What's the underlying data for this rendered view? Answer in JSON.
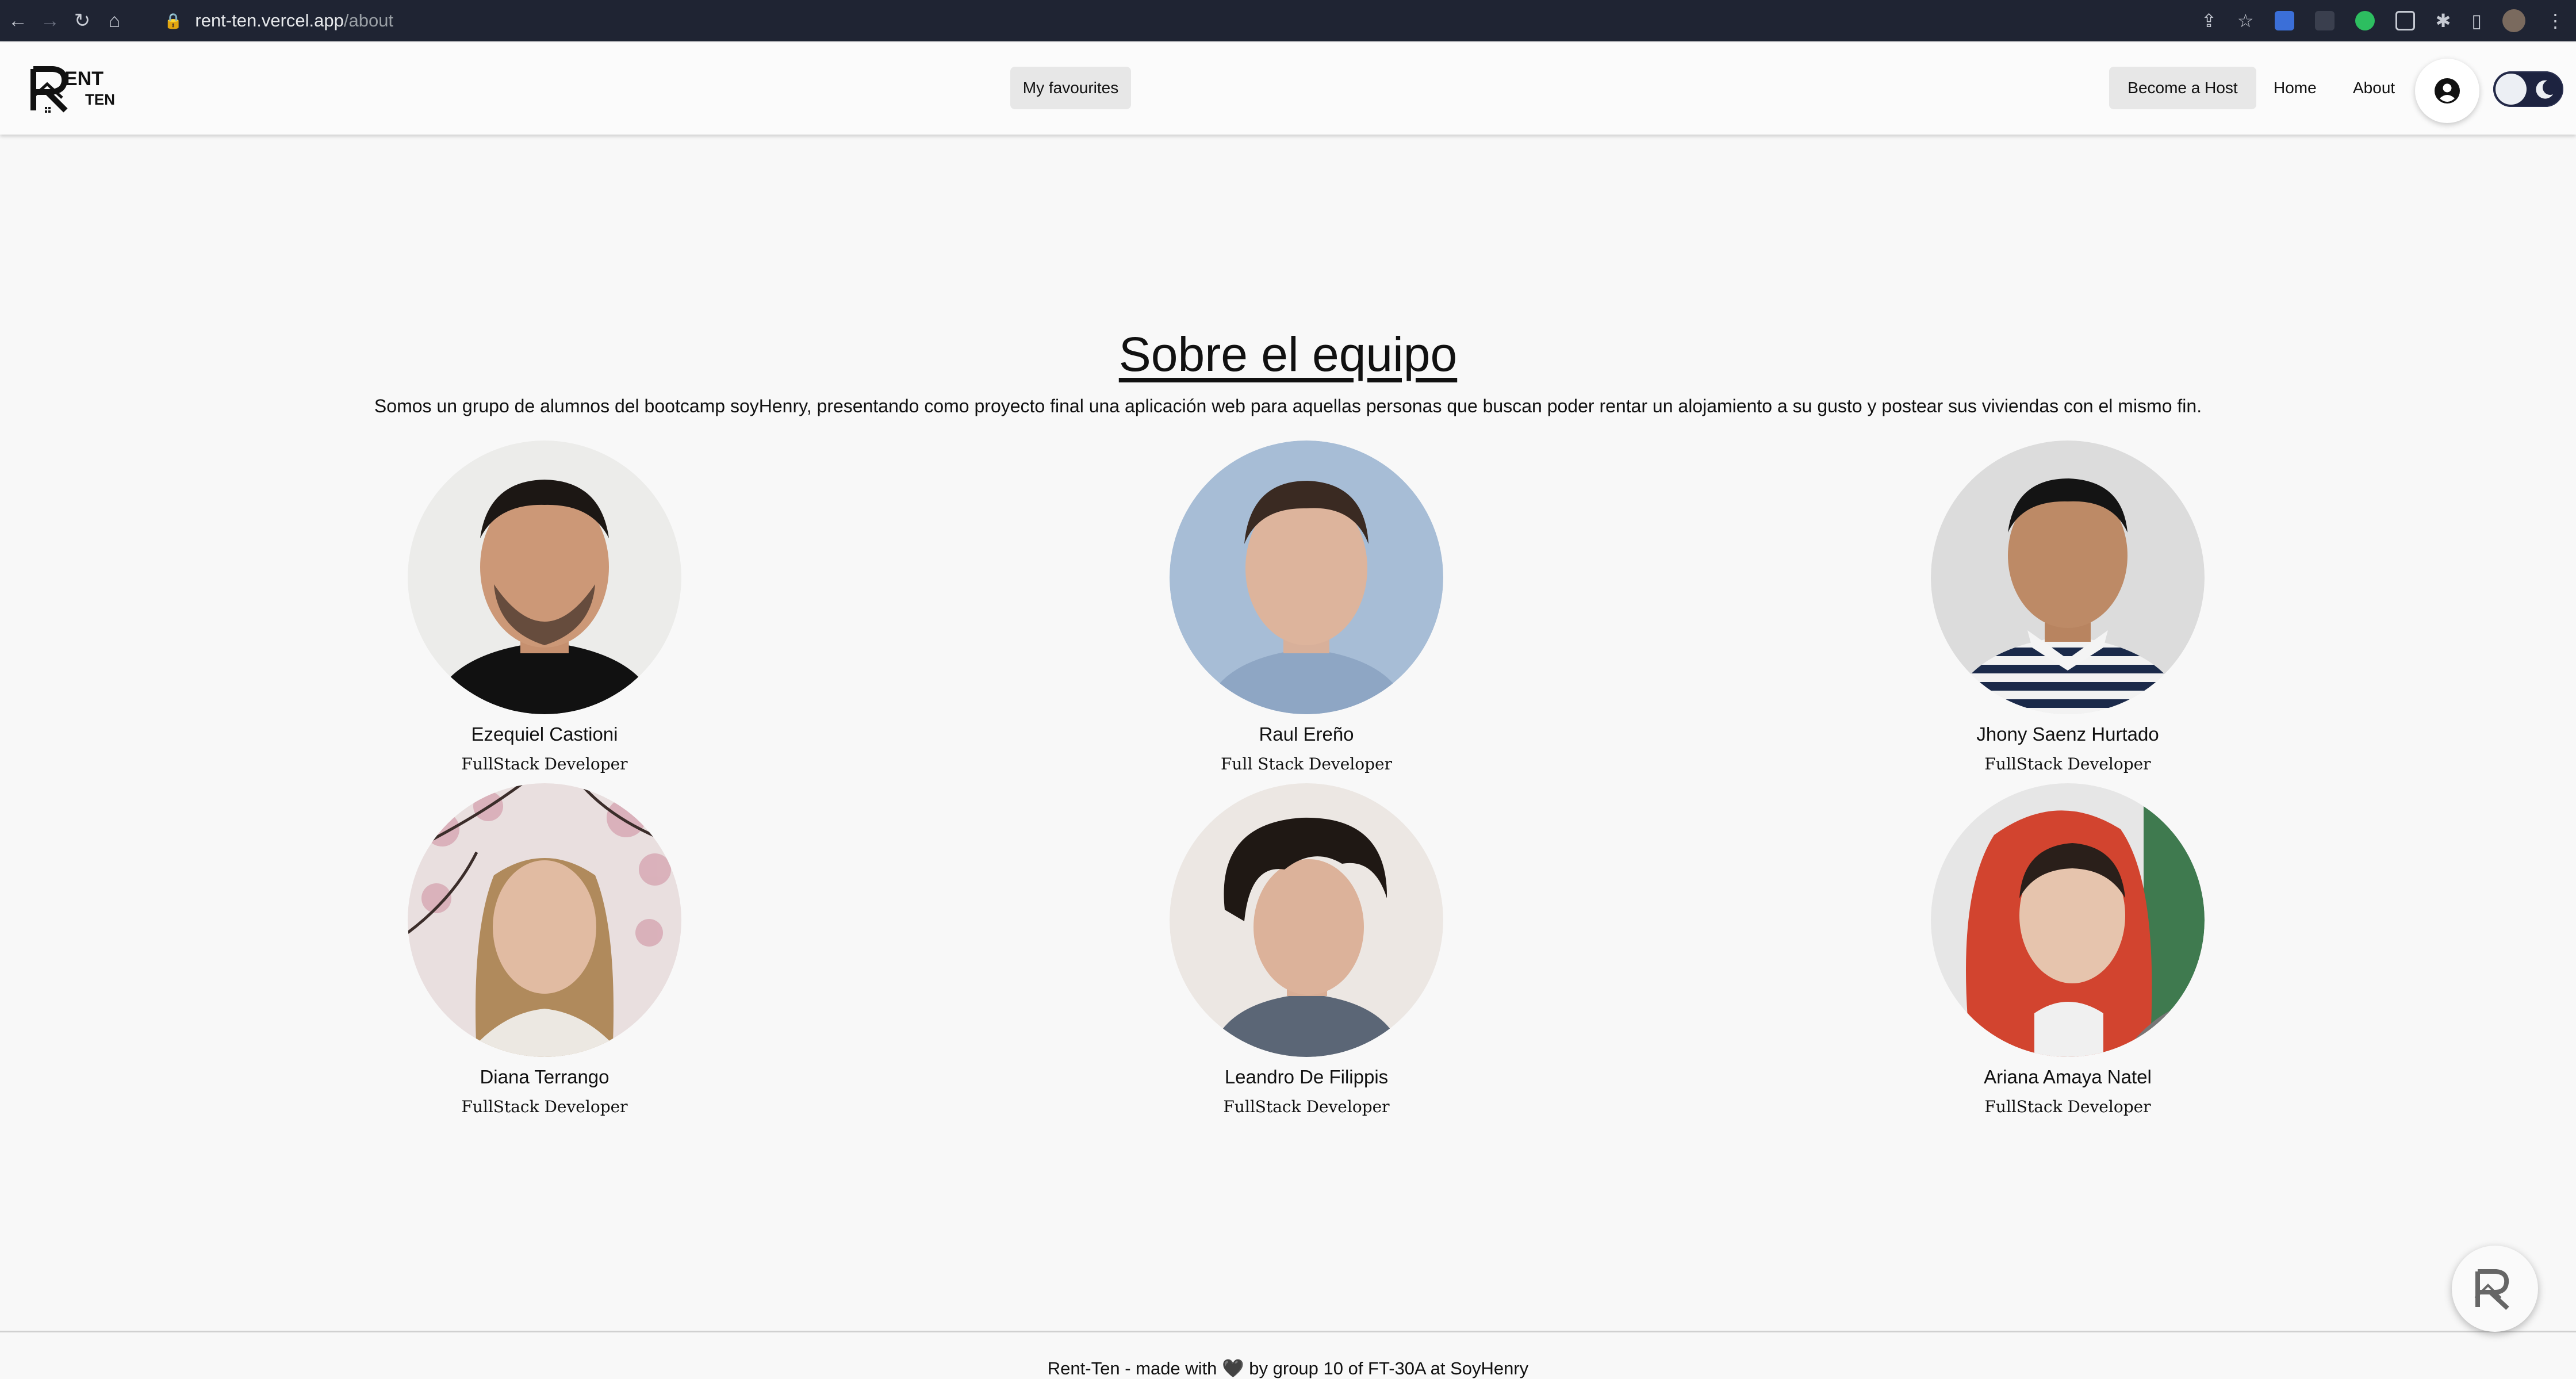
{
  "browser": {
    "url_host": "rent-ten.vercel.app",
    "url_path": "/about"
  },
  "header": {
    "logo_text": "RENT TEN",
    "favourites_label": "My favourites",
    "become_host_label": "Become a Host",
    "home_label": "Home",
    "about_label": "About"
  },
  "main": {
    "title": "Sobre el equipo",
    "intro": "Somos un grupo de alumnos del bootcamp soyHenry, presentando como proyecto final una aplicación web para aquellas personas que buscan poder rentar un alojamiento a su gusto y postear sus viviendas con el mismo fin.",
    "members": [
      {
        "name": "Ezequiel Castioni",
        "role": "FullStack Developer"
      },
      {
        "name": "Raul Ereño",
        "role": "Full Stack Developer"
      },
      {
        "name": "Jhony Saenz Hurtado",
        "role": "FullStack Developer"
      },
      {
        "name": "Diana Terrango",
        "role": "FullStack Developer"
      },
      {
        "name": "Leandro De Filippis",
        "role": "FullStack Developer"
      },
      {
        "name": "Ariana Amaya Natel",
        "role": "FullStack Developer"
      }
    ]
  },
  "footer": {
    "text": "Rent-Ten - made with 🖤 by group 10 of FT-30A at SoyHenry"
  },
  "colors": {
    "background": "#f8f8f8",
    "toggle": "#1d2340",
    "chrome": "#1f2433"
  }
}
